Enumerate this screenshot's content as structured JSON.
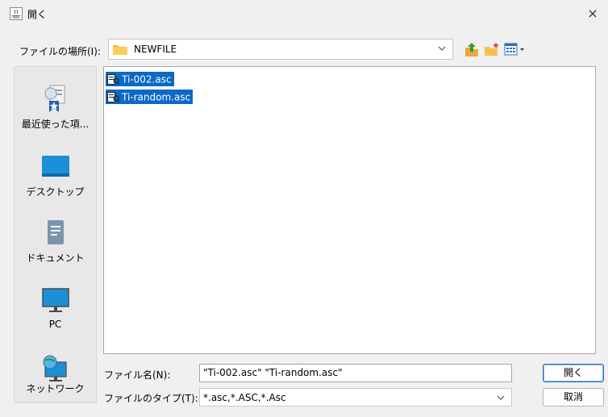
{
  "window": {
    "title": "開く",
    "close_label": "×"
  },
  "look_in": {
    "label": "ファイルの場所(I):",
    "value": "NEWFILE"
  },
  "toolbar": {
    "icons": [
      "up-folder-icon",
      "new-folder-icon",
      "view-menu-icon"
    ]
  },
  "places": [
    {
      "label": "最近使った項...",
      "icon": "recent-icon"
    },
    {
      "label": "デスクトップ",
      "icon": "desktop-icon"
    },
    {
      "label": "ドキュメント",
      "icon": "documents-icon"
    },
    {
      "label": "PC",
      "icon": "pc-icon"
    },
    {
      "label": "ネットワーク",
      "icon": "network-icon"
    }
  ],
  "files": [
    {
      "name": "Ti-002.asc",
      "selected": true
    },
    {
      "name": "Ti-random.asc",
      "selected": true
    }
  ],
  "file_name": {
    "label": "ファイル名(N):",
    "value": "\"Ti-002.asc\" \"Ti-random.asc\""
  },
  "file_type": {
    "label": "ファイルのタイプ(T):",
    "value": "*.asc,*.ASC,*.Asc"
  },
  "buttons": {
    "open": "開く",
    "cancel": "取消"
  },
  "colors": {
    "selection": "#0b69c7",
    "folder": "#f6c245",
    "accent": "#2b6fc4"
  }
}
